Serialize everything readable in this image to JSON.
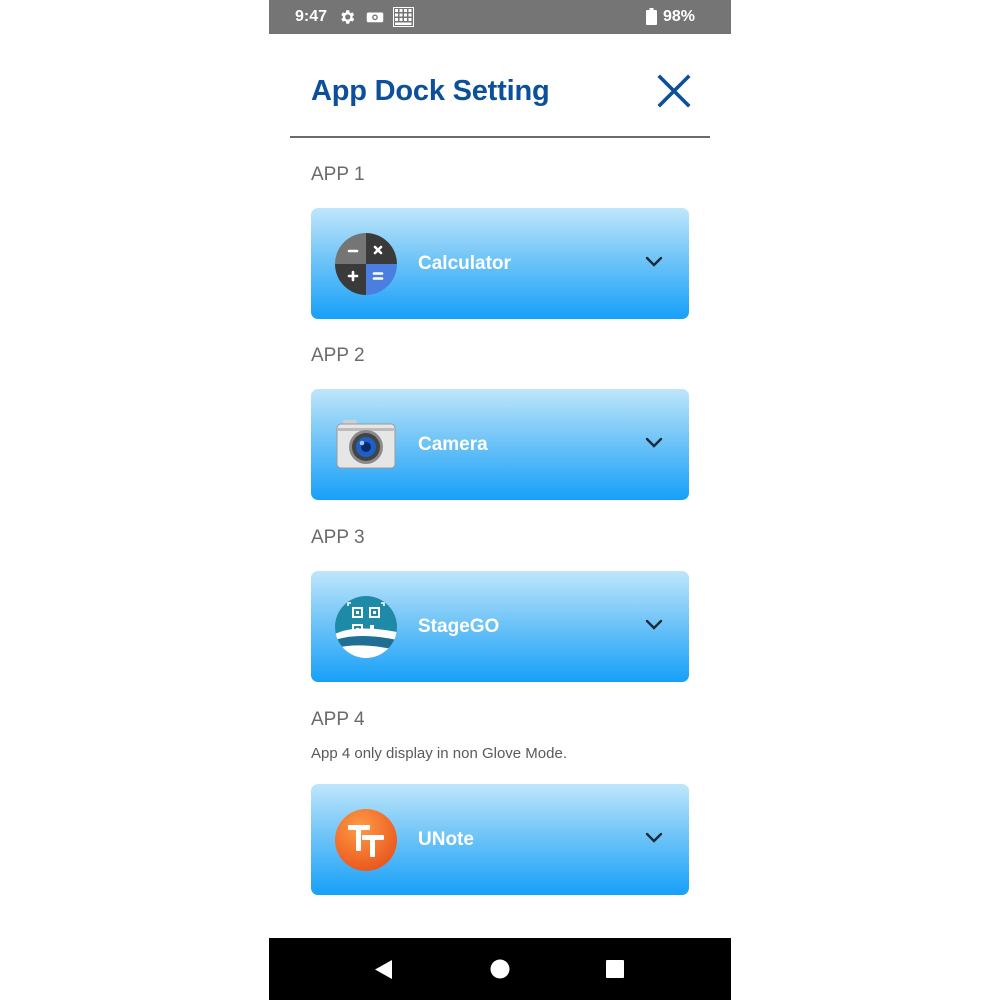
{
  "status_bar": {
    "time": "9:47",
    "battery": "98%",
    "icons": [
      "gear-icon",
      "camera-notification-icon",
      "keyboard-grid-icon",
      "battery-icon"
    ]
  },
  "header": {
    "title": "App Dock Setting",
    "close_icon": "close-icon"
  },
  "apps": [
    {
      "label": "APP 1",
      "name": "Calculator",
      "icon": "calculator-icon"
    },
    {
      "label": "APP 2",
      "name": "Camera",
      "icon": "camera-icon"
    },
    {
      "label": "APP 3",
      "name": "StageGO",
      "icon": "stagego-icon"
    },
    {
      "label": "APP 4",
      "name": "UNote",
      "icon": "unote-icon"
    }
  ],
  "app4_note": "App 4 only display in non Glove Mode.",
  "colors": {
    "title": "#0c4f9a",
    "status_bar": "#757575",
    "card_top": "#bfe6fb",
    "card_bottom": "#17a0f9",
    "nav_bar": "#000000"
  },
  "nav_bar": {
    "icons": [
      "back-icon",
      "home-icon",
      "recents-icon"
    ]
  }
}
